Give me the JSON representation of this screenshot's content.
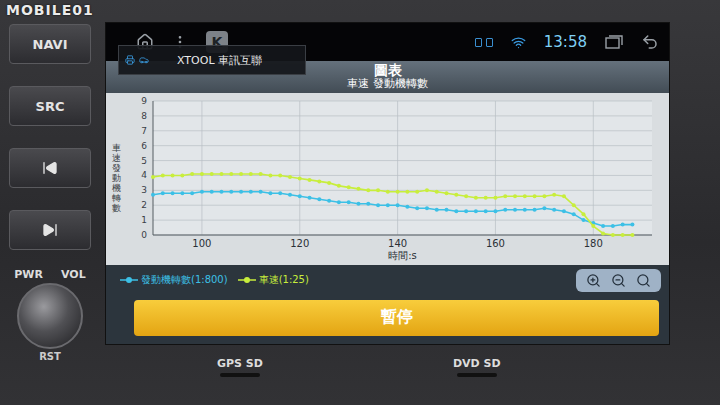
{
  "watermark": "MOBILE01",
  "bezel": {
    "left_buttons": [
      "NAVI",
      "SRC"
    ],
    "knob_labels": [
      "PWR",
      "VOL"
    ],
    "reset": "RST",
    "slots": [
      "GPS SD",
      "DVD SD"
    ]
  },
  "status_bar": {
    "app_badge": "K",
    "time": "13:58"
  },
  "popup": {
    "title": "XTOOL 車訊互聯"
  },
  "app": {
    "title": "圖表",
    "subtitle": "車速 發動機轉數"
  },
  "chart": {
    "y_axis_label": "車速 發動機轉數",
    "y_ticks": [
      "0",
      "1",
      "2",
      "3",
      "4",
      "5",
      "6",
      "7",
      "8",
      "9"
    ],
    "x_ticks": [
      "100",
      "120",
      "140",
      "160",
      "180"
    ],
    "x_axis_title": "時間:s",
    "x_min": 90,
    "x_max": 192,
    "x_start": 90,
    "x_step": 2,
    "y_max": 9,
    "series": [
      {
        "name": "發動機轉數(1:800)",
        "color": "#3cc0e6",
        "values": [
          2.7,
          2.8,
          2.8,
          2.8,
          2.8,
          2.9,
          2.9,
          2.9,
          2.9,
          2.9,
          2.9,
          2.9,
          2.8,
          2.8,
          2.7,
          2.6,
          2.5,
          2.4,
          2.3,
          2.2,
          2.2,
          2.1,
          2.1,
          2.0,
          2.0,
          2.0,
          1.9,
          1.8,
          1.8,
          1.7,
          1.7,
          1.6,
          1.6,
          1.6,
          1.6,
          1.6,
          1.7,
          1.7,
          1.7,
          1.7,
          1.8,
          1.7,
          1.6,
          1.4,
          1.0,
          0.8,
          0.6,
          0.6,
          0.7,
          0.7
        ]
      },
      {
        "name": "車速(1:25)",
        "color": "#c8ee3c",
        "values": [
          3.9,
          4.0,
          4.0,
          4.0,
          4.1,
          4.1,
          4.1,
          4.1,
          4.1,
          4.1,
          4.1,
          4.1,
          4.0,
          4.0,
          3.9,
          3.8,
          3.7,
          3.6,
          3.5,
          3.3,
          3.2,
          3.1,
          3.0,
          3.0,
          2.9,
          2.9,
          2.9,
          2.9,
          3.0,
          2.9,
          2.8,
          2.7,
          2.6,
          2.5,
          2.5,
          2.5,
          2.6,
          2.6,
          2.6,
          2.6,
          2.6,
          2.7,
          2.6,
          2.0,
          1.4,
          0.6,
          0.1,
          0,
          0,
          0
        ]
      }
    ]
  },
  "button": {
    "label": "暫停"
  }
}
